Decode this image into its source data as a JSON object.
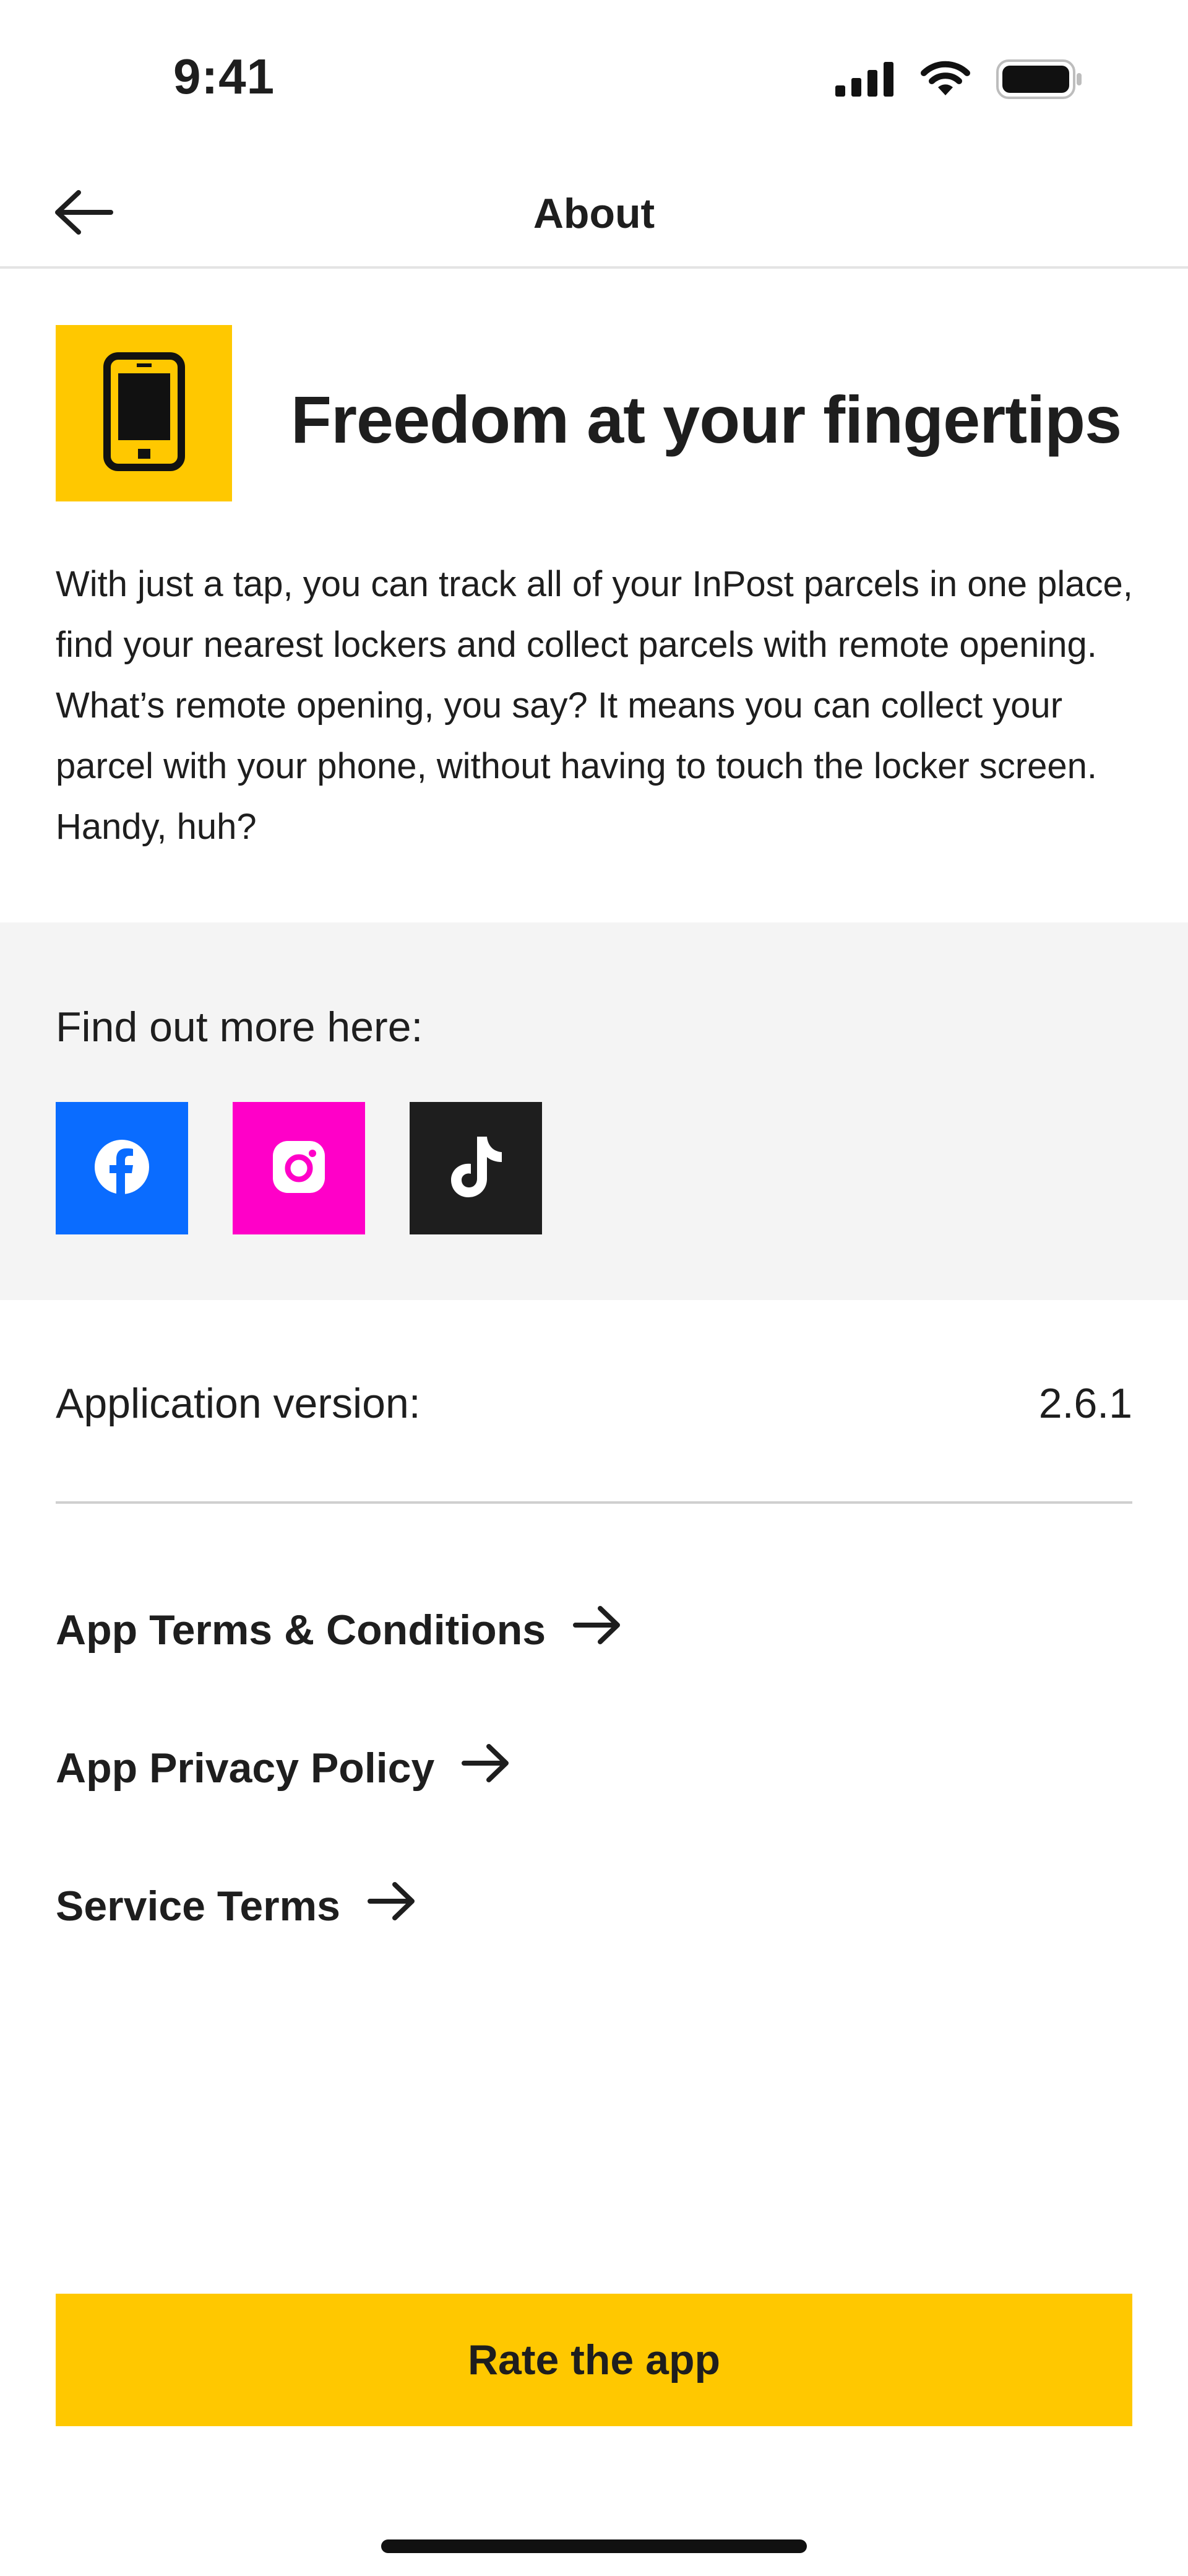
{
  "status_bar": {
    "time": "9:41",
    "icons": [
      "signal-icon",
      "wifi-icon",
      "battery-icon"
    ]
  },
  "nav": {
    "title": "About",
    "back_icon": "arrow-left-icon"
  },
  "hero": {
    "icon": "phone-icon",
    "title": "Freedom at your fingertips",
    "description": "With just a tap, you can track all of your InPost parcels in one place, find your nearest lockers and collect parcels with remote opening. What’s remote opening, you say? It means you can collect your parcel with your phone, without having to touch the locker screen. Handy, huh?"
  },
  "social": {
    "label": "Find out more here:",
    "items": [
      {
        "icon": "facebook-icon",
        "color": "#0a6cff"
      },
      {
        "icon": "instagram-icon",
        "color": "#ff00c8"
      },
      {
        "icon": "tiktok-icon",
        "color": "#1e1e1e"
      }
    ]
  },
  "version": {
    "label": "Application version:",
    "value": "2.6.1"
  },
  "links": [
    {
      "label": "App Terms & Conditions",
      "icon": "arrow-right-icon"
    },
    {
      "label": "App Privacy Policy",
      "icon": "arrow-right-icon"
    },
    {
      "label": "Service Terms",
      "icon": "arrow-right-icon"
    }
  ],
  "rate_button": {
    "label": "Rate the app",
    "color": "#ffc800"
  },
  "colors": {
    "accent": "#ffc800",
    "text": "#1e1e1e",
    "section_bg": "#f4f4f4"
  }
}
